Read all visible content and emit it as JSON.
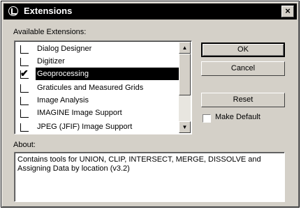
{
  "window": {
    "title": "Extensions",
    "close_label": "×"
  },
  "available_label": "Available Extensions:",
  "extensions": [
    {
      "label": "Dialog Designer",
      "checked": false,
      "selected": false
    },
    {
      "label": "Digitizer",
      "checked": false,
      "selected": false
    },
    {
      "label": "Geoprocessing",
      "checked": true,
      "selected": true
    },
    {
      "label": "Graticules and Measured Grids",
      "checked": false,
      "selected": false
    },
    {
      "label": "Image Analysis",
      "checked": false,
      "selected": false
    },
    {
      "label": "IMAGINE Image Support",
      "checked": false,
      "selected": false
    },
    {
      "label": "JPEG (JFIF) Image Support",
      "checked": false,
      "selected": false
    }
  ],
  "buttons": {
    "ok": "OK",
    "cancel": "Cancel",
    "reset": "Reset"
  },
  "make_default_label": "Make Default",
  "about_label": "About:",
  "about_text": "Contains tools for UNION, CLIP, INTERSECT, MERGE, DISSOLVE and Assigning Data by location (v3.2)",
  "icons": {
    "check": "✔",
    "up": "▲",
    "down": "▼"
  }
}
